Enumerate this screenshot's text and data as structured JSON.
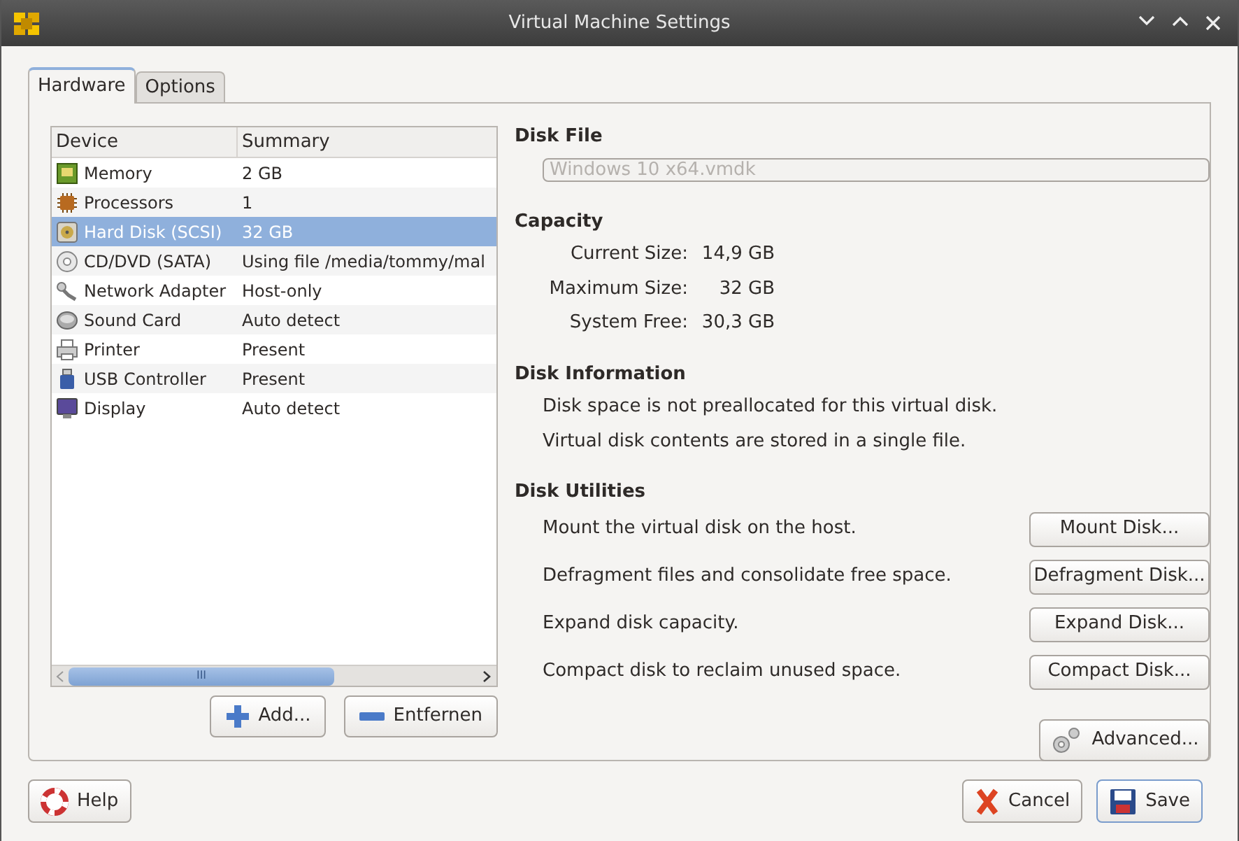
{
  "window": {
    "title": "Virtual Machine Settings"
  },
  "tabs": [
    {
      "label": "Hardware",
      "selected": true
    },
    {
      "label": "Options",
      "selected": false
    }
  ],
  "devices": {
    "columns": [
      "Device",
      "Summary"
    ],
    "rows": [
      {
        "kind": "memory",
        "device": "Memory",
        "summary": "2 GB",
        "selected": false
      },
      {
        "kind": "processor",
        "device": "Processors",
        "summary": "1",
        "selected": false
      },
      {
        "kind": "disk",
        "device": "Hard Disk (SCSI)",
        "summary": "32 GB",
        "selected": true
      },
      {
        "kind": "cd",
        "device": "CD/DVD (SATA)",
        "summary": "Using file /media/tommy/mal",
        "selected": false
      },
      {
        "kind": "network",
        "device": "Network Adapter",
        "summary": "Host-only",
        "selected": false
      },
      {
        "kind": "sound",
        "device": "Sound Card",
        "summary": "Auto detect",
        "selected": false
      },
      {
        "kind": "printer",
        "device": "Printer",
        "summary": "Present",
        "selected": false
      },
      {
        "kind": "usb",
        "device": "USB Controller",
        "summary": "Present",
        "selected": false
      },
      {
        "kind": "display",
        "device": "Display",
        "summary": "Auto detect",
        "selected": false
      }
    ],
    "scroll_glyph": "III",
    "buttons": [
      {
        "kind": "add",
        "label": "Add..."
      },
      {
        "kind": "remove",
        "label": "Entfernen"
      }
    ]
  },
  "disk_file": {
    "heading": "Disk File",
    "value": "Windows 10 x64.vmdk"
  },
  "capacity": {
    "heading": "Capacity",
    "rows": [
      {
        "label": "Current Size:",
        "value": "14,9 GB"
      },
      {
        "label": "Maximum Size:",
        "value": "32 GB"
      },
      {
        "label": "System Free:",
        "value": "30,3 GB"
      }
    ]
  },
  "disk_information": {
    "heading": "Disk Information",
    "lines": [
      "Disk space is not preallocated for this virtual disk.",
      "Virtual disk contents are stored in a single file."
    ]
  },
  "disk_utilities": {
    "heading": "Disk Utilities",
    "rows": [
      {
        "text": "Mount the virtual disk on the host.",
        "button": "Mount Disk..."
      },
      {
        "text": "Defragment files and consolidate free space.",
        "button": "Defragment Disk..."
      },
      {
        "text": "Expand disk capacity.",
        "button": "Expand Disk..."
      },
      {
        "text": "Compact disk to reclaim unused space.",
        "button": "Compact Disk..."
      }
    ],
    "advanced": "Advanced..."
  },
  "footer": [
    {
      "kind": "help",
      "label": "Help"
    },
    {
      "kind": "cancel",
      "label": "Cancel"
    },
    {
      "kind": "save",
      "label": "Save"
    }
  ]
}
